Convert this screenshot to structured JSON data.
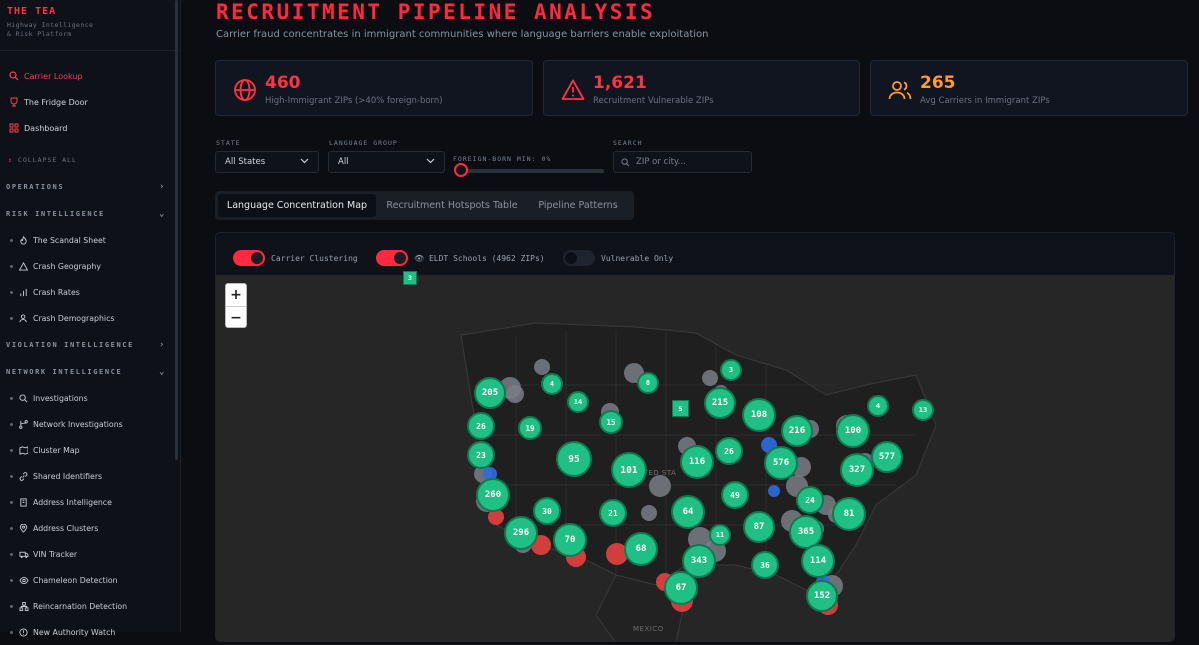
{
  "brand": {
    "title": "THE TEA",
    "subtitle_1": "Highway Intelligence",
    "subtitle_2": "& Risk Platform"
  },
  "topnav": [
    {
      "label": "Carrier Lookup",
      "icon": "search-icon",
      "active": true
    },
    {
      "label": "The Fridge Door",
      "icon": "trophy-icon",
      "active": false
    },
    {
      "label": "Dashboard",
      "icon": "grid-icon",
      "active": false
    }
  ],
  "collapse_label": "COLLAPSE ALL",
  "sections": {
    "operations": "OPERATIONS",
    "risk": "RISK INTELLIGENCE",
    "violation": "VIOLATION INTELLIGENCE",
    "network": "NETWORK INTELLIGENCE"
  },
  "risk_items": [
    {
      "label": "The Scandal Sheet",
      "icon": "flame-icon"
    },
    {
      "label": "Crash Geography",
      "icon": "warning-icon"
    },
    {
      "label": "Crash Rates",
      "icon": "bar-chart-icon"
    },
    {
      "label": "Crash Demographics",
      "icon": "users-icon"
    }
  ],
  "network_items": [
    {
      "label": "Investigations",
      "icon": "search-icon"
    },
    {
      "label": "Network Investigations",
      "icon": "branch-icon"
    },
    {
      "label": "Cluster Map",
      "icon": "map-icon"
    },
    {
      "label": "Shared Identifiers",
      "icon": "link-icon"
    },
    {
      "label": "Address Intelligence",
      "icon": "building-icon"
    },
    {
      "label": "Address Clusters",
      "icon": "pin-icon"
    },
    {
      "label": "VIN Tracker",
      "icon": "truck-icon"
    },
    {
      "label": "Chameleon Detection",
      "icon": "eye-icon"
    },
    {
      "label": "Reincarnation Detection",
      "icon": "network-icon"
    },
    {
      "label": "New Authority Watch",
      "icon": "shield-icon"
    }
  ],
  "page": {
    "title": "RECRUITMENT PIPELINE ANALYSIS",
    "subtitle": "Carrier fraud concentrates in immigrant communities where language barriers enable exploitation"
  },
  "stats": [
    {
      "value": "460",
      "label": "High-Immigrant ZIPs (>40% foreign-born)",
      "color": "#ff3344",
      "icon": "globe-icon"
    },
    {
      "value": "1,621",
      "label": "Recruitment Vulnerable ZIPs",
      "color": "#ff3344",
      "icon": "warning-icon"
    },
    {
      "value": "265",
      "label": "Avg Carriers in Immigrant ZIPs",
      "color": "#ff9b2f",
      "icon": "users-icon"
    }
  ],
  "filters": {
    "state_label": "STATE",
    "state_value": "All States",
    "language_label": "LANGUAGE GROUP",
    "language_value": "All",
    "foreign_label": "FOREIGN-BORN MIN: 0%",
    "foreign_value": 0,
    "search_label": "SEARCH",
    "search_placeholder": "ZIP or city..."
  },
  "tabs": [
    {
      "label": "Language Concentration Map",
      "active": true
    },
    {
      "label": "Recruitment Hotspots Table",
      "active": false
    },
    {
      "label": "Pipeline Patterns",
      "active": false
    }
  ],
  "toggles": [
    {
      "label": "Carrier Clustering",
      "on": true
    },
    {
      "label": "ELDT Schools (4962 ZIPs)",
      "on": true
    },
    {
      "label": "Vulnerable Only",
      "on": false
    }
  ],
  "map": {
    "zoom_in": "+",
    "zoom_out": "−",
    "country_label_1": "ITED STA",
    "country_label_2": "MEXICO",
    "clusters": [
      "205",
      "4",
      "8",
      "3",
      "14",
      "5",
      "215",
      "108",
      "4",
      "13",
      "26",
      "19",
      "15",
      "216",
      "100",
      "23",
      "95",
      "101",
      "116",
      "26",
      "576",
      "327",
      "577",
      "260",
      "30",
      "21",
      "64",
      "49",
      "24",
      "81",
      "296",
      "70",
      "68",
      "11",
      "87",
      "365",
      "343",
      "36",
      "114",
      "67",
      "152"
    ],
    "squares": [
      "3",
      "5"
    ]
  }
}
